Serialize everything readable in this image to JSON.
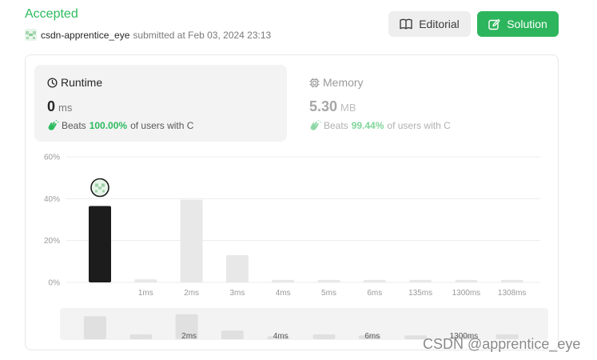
{
  "submission": {
    "status": "Accepted",
    "username": "csdn-apprentice_eye",
    "submitted_text": "submitted at",
    "timestamp": "Feb 03, 2024 23:13"
  },
  "actions": {
    "editorial_label": "Editorial",
    "solution_label": "Solution"
  },
  "runtime": {
    "title": "Runtime",
    "value": "0",
    "unit": "ms",
    "beats_label": "Beats",
    "beats_pct": "100.00%",
    "beats_suffix": "of users with C"
  },
  "memory": {
    "title": "Memory",
    "value": "5.30",
    "unit": "MB",
    "beats_label": "Beats",
    "beats_pct": "99.44%",
    "beats_suffix": "of users with C"
  },
  "chart_data": {
    "type": "bar",
    "categories": [
      "",
      "1ms",
      "2ms",
      "3ms",
      "4ms",
      "5ms",
      "6ms",
      "135ms",
      "1300ms",
      "1308ms"
    ],
    "values": [
      36.5,
      1.5,
      39.5,
      13,
      1.2,
      1.2,
      1.2,
      1.2,
      1.2,
      1.2
    ],
    "highlight_index": 0,
    "y_ticks": [
      "60%",
      "40%",
      "20%",
      "0%"
    ],
    "ylim": [
      0,
      60
    ],
    "grid": true,
    "colors": {
      "highlight": "#1c1c1c",
      "bar": "#e8e8e8",
      "grid": "#ececec"
    },
    "overview": {
      "values": [
        12,
        2.5,
        13,
        4.5,
        1.5,
        2.5,
        2,
        2,
        2,
        2.5
      ],
      "labels": [
        "",
        "",
        "2ms",
        "",
        "4ms",
        "",
        "6ms",
        "",
        "1300ms",
        ""
      ]
    }
  },
  "watermark": "CSDN @apprentice_eye"
}
